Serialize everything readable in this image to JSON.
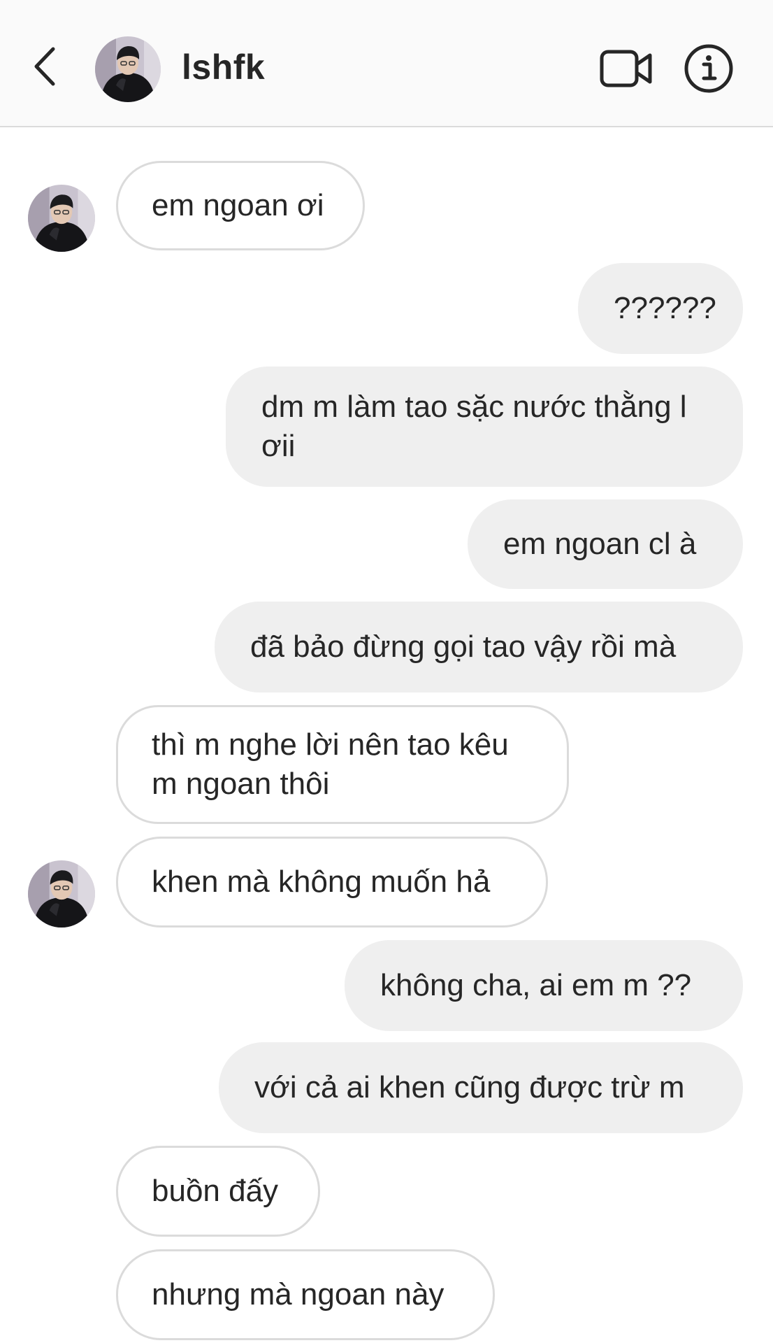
{
  "header": {
    "username": "lshfk",
    "icons": {
      "back": "chevron-left-icon",
      "video": "video-camera-icon",
      "info": "info-circle-icon"
    }
  },
  "messages": [
    {
      "from": "them",
      "text": "em ngoan ơi"
    },
    {
      "from": "me",
      "text": "??????"
    },
    {
      "from": "me",
      "text": "dm m làm tao sặc nước thằng l ơii"
    },
    {
      "from": "me",
      "text": "em ngoan cl à"
    },
    {
      "from": "me",
      "text": "đã bảo đừng gọi tao vậy rồi mà"
    },
    {
      "from": "them",
      "text": "thì m nghe lời nên tao kêu m ngoan thôi"
    },
    {
      "from": "them",
      "text": "khen mà không muốn hả"
    },
    {
      "from": "me",
      "text": "không cha, ai em m ??"
    },
    {
      "from": "me",
      "text": "với cả ai khen cũng được trừ m"
    },
    {
      "from": "them",
      "text": "buồn đấy"
    },
    {
      "from": "them",
      "text": "nhưng mà ngoan này"
    }
  ],
  "colors": {
    "header_bg": "#fafafa",
    "incoming_border": "#dbdbdb",
    "outgoing_bg": "#efefef",
    "text": "#262626"
  }
}
